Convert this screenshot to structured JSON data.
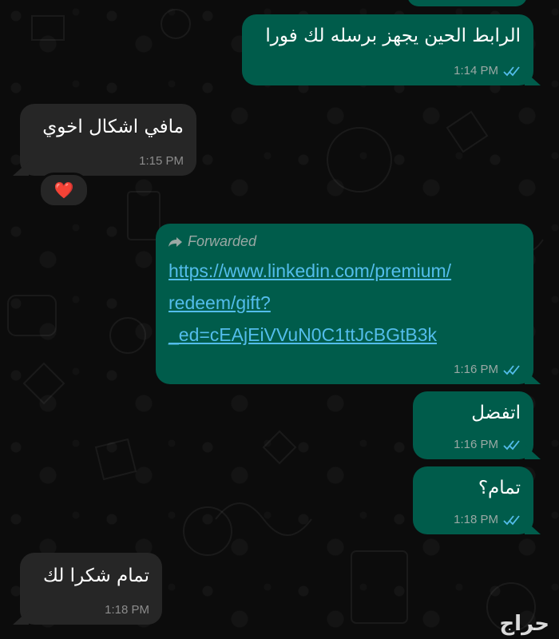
{
  "messages": [
    {
      "id": "m1",
      "direction": "outgoing",
      "text": "الرابط الحين يجهز برسله لك فورا",
      "time": "1:14 PM",
      "status": "read"
    },
    {
      "id": "m2",
      "direction": "incoming",
      "text": "مافي اشكال اخوي",
      "time": "1:15 PM",
      "reaction": "❤️"
    },
    {
      "id": "m3",
      "direction": "outgoing",
      "forwarded_label": "Forwarded",
      "link_lines": [
        "https://www.linkedin.com/premium/",
        "redeem/gift?",
        "_ed=cEAjEiVVuN0C1ttJcBGtB3k"
      ],
      "time": "1:16 PM",
      "status": "read"
    },
    {
      "id": "m4",
      "direction": "outgoing",
      "text": "اتفضل",
      "time": "1:16 PM",
      "status": "read"
    },
    {
      "id": "m5",
      "direction": "outgoing",
      "text": "تمام؟",
      "time": "1:18 PM",
      "status": "read"
    },
    {
      "id": "m6",
      "direction": "incoming",
      "text": "تمام شكرا لك",
      "time": "1:18 PM"
    }
  ],
  "watermark": "حراج",
  "colors": {
    "outgoing_bubble": "#005c4b",
    "incoming_bubble": "#262626",
    "link": "#53bdeb",
    "read_ticks": "#53bdeb",
    "background": "#0c0c0c"
  },
  "icons": [
    "double-check-icon",
    "forward-arrow-icon",
    "heart-reaction-icon"
  ]
}
